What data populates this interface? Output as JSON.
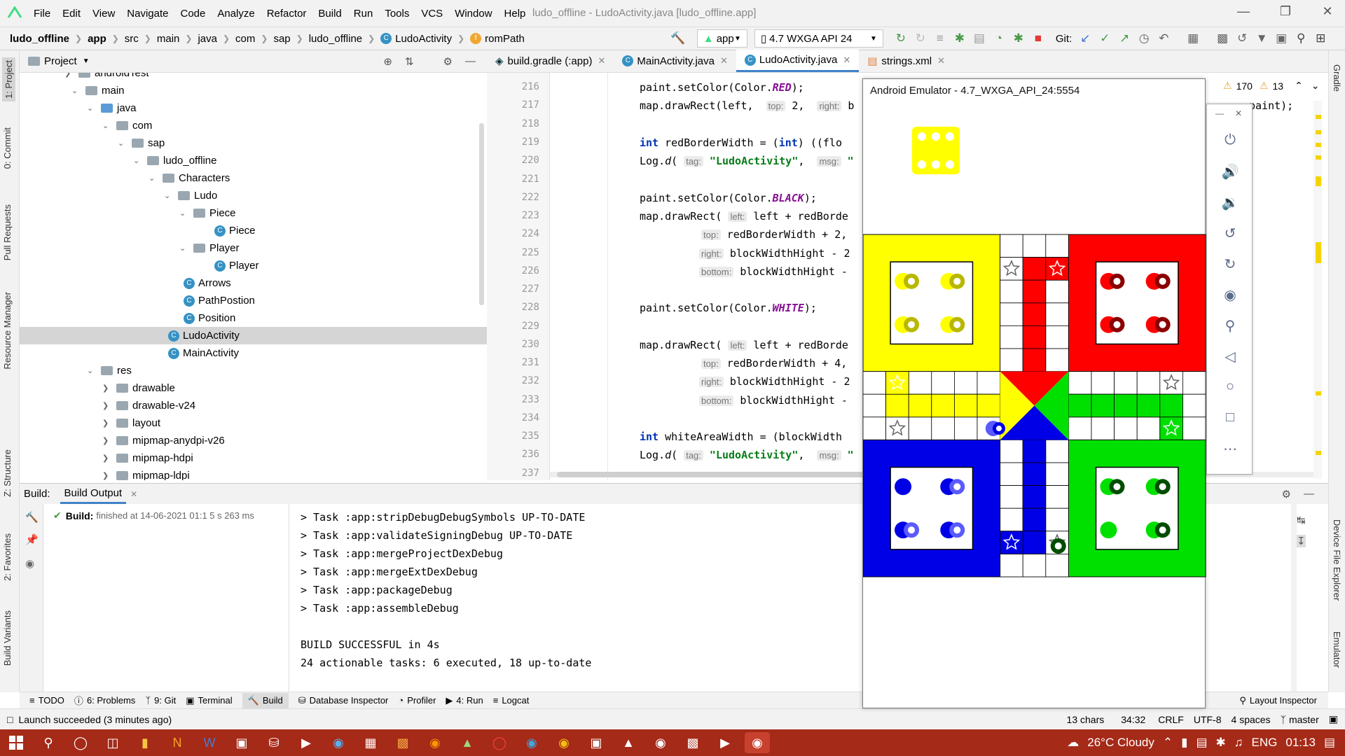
{
  "menu": {
    "items": [
      "File",
      "Edit",
      "View",
      "Navigate",
      "Code",
      "Analyze",
      "Refactor",
      "Build",
      "Run",
      "Tools",
      "VCS",
      "Window",
      "Help"
    ],
    "title": "ludo_offline - LudoActivity.java [ludo_offline.app]"
  },
  "nav": {
    "breadcrumbs": [
      "ludo_offline",
      "app",
      "src",
      "main",
      "java",
      "com",
      "sap",
      "ludo_offline",
      "LudoActivity",
      "romPath"
    ],
    "run_config": "app",
    "device": "4.7  WXGA API 24",
    "git_label": "Git:"
  },
  "project": {
    "label": "Project"
  },
  "tree": [
    {
      "label": "androidTest"
    },
    {
      "label": "main"
    },
    {
      "label": "java"
    },
    {
      "label": "com"
    },
    {
      "label": "sap"
    },
    {
      "label": "ludo_offline"
    },
    {
      "label": "Characters"
    },
    {
      "label": "Ludo"
    },
    {
      "label": "Piece"
    },
    {
      "label": "Piece"
    },
    {
      "label": "Player"
    },
    {
      "label": "Player"
    },
    {
      "label": "Arrows"
    },
    {
      "label": "PathPostion"
    },
    {
      "label": "Position"
    },
    {
      "label": "LudoActivity"
    },
    {
      "label": "MainActivity"
    },
    {
      "label": "res"
    },
    {
      "label": "drawable"
    },
    {
      "label": "drawable-v24"
    },
    {
      "label": "layout"
    },
    {
      "label": "mipmap-anydpi-v26"
    },
    {
      "label": "mipmap-hdpi"
    },
    {
      "label": "mipmap-ldpi"
    }
  ],
  "editor_tabs": [
    "build.gradle (:app)",
    "MainActivity.java",
    "LudoActivity.java",
    "strings.xml"
  ],
  "line_numbers": [
    "216",
    "217",
    "218",
    "219",
    "220",
    "221",
    "222",
    "223",
    "224",
    "225",
    "226",
    "227",
    "228",
    "229",
    "230",
    "231",
    "232",
    "233",
    "234",
    "235",
    "236",
    "237"
  ],
  "code": {
    "l216a": "paint.setColor(Color.",
    "l216b": "RED",
    "l216c": ");",
    "l217a": "map.drawRect(left,  ",
    "l217h1": "top:",
    "l217b": " 2,  ",
    "l217h2": "right:",
    "l217c": " b",
    "l219a": "int",
    "l219b": " redBorderWidth = (",
    "l219c": "int",
    "l219d": ") ((flo",
    "l220a": "Log.",
    "l220b": "d",
    "l220c": "( ",
    "l220h": "tag:",
    "l220s": " \"LudoActivity\"",
    "l220d": ",  ",
    "l220h2": "msg:",
    "l220e": " \"",
    "l222a": "paint.setColor(Color.",
    "l222b": "BLACK",
    "l222c": ");",
    "l223a": "map.drawRect( ",
    "l223h": "left:",
    "l223b": " left + redBorde",
    "l224h": "top:",
    "l224b": " redBorderWidth + 2,",
    "l225h": "right:",
    "l225b": " blockWidthHight - 2",
    "l226h": "bottom:",
    "l226b": " blockWidthHight -",
    "l228a": "paint.setColor(Color.",
    "l228b": "WHITE",
    "l228c": ");",
    "l230a": "map.drawRect( ",
    "l230h": "left:",
    "l230b": " left + redBorde",
    "l231h": "top:",
    "l231b": " redBorderWidth + 4,",
    "l232h": "right:",
    "l232b": " blockWidthHight - 2",
    "l233h": "bottom:",
    "l233b": " blockWidthHight -",
    "l235a": "int",
    "l235b": " whiteAreaWidth = (blockWidth",
    "l236a": "Log.",
    "l236b": "d",
    "l236c": "( ",
    "l236h": "tag:",
    "l236s": " \"LudoActivity\"",
    "l236d": ",  ",
    "l236h2": "msg:",
    "l236e": " \"",
    "right_fragment": "paint);"
  },
  "inspections": {
    "warnings": "170",
    "weak": "13"
  },
  "emulator": {
    "title": "Android Emulator - 4.7_WXGA_API_24:5554",
    "dice_value": 6
  },
  "build": {
    "tab_build": "Build:",
    "tab_output": "Build Output",
    "status_label": "Build:",
    "status_text": "finished at 14-06-2021 01:1 5 s 263 ms",
    "lines": [
      "> Task :app:stripDebugDebugSymbols UP-TO-DATE",
      "> Task :app:validateSigningDebug UP-TO-DATE",
      "> Task :app:mergeProjectDexDebug",
      "> Task :app:mergeExtDexDebug",
      "> Task :app:packageDebug",
      "> Task :app:assembleDebug",
      "",
      "BUILD SUCCESSFUL in 4s",
      "24 actionable tasks: 6 executed, 18 up-to-date"
    ]
  },
  "tool_tabs": [
    "TODO",
    "6: Problems",
    "9: Git",
    "Terminal",
    "Build",
    "Database Inspector",
    "Profiler",
    "4: Run",
    "Logcat",
    "Layout Inspector"
  ],
  "status": {
    "message": "Launch succeeded (3 minutes ago)",
    "chars": "13 chars",
    "position": "34:32",
    "line_sep": "CRLF",
    "encoding": "UTF-8",
    "indent": "4 spaces",
    "branch": "master"
  },
  "left_tabs": [
    "1: Project",
    "0: Commit",
    "Pull Requests",
    "Resource Manager",
    "Z: Structure",
    "2: Favorites",
    "Build Variants"
  ],
  "right_tabs": [
    "Gradle",
    "Device File Explorer",
    "Emulator"
  ],
  "taskbar": {
    "weather": "26°C  Cloudy",
    "lang": "ENG",
    "time": "01:13"
  },
  "colors": {
    "ludo_yellow": "#ffff00",
    "ludo_red": "#ff0000",
    "ludo_green": "#00e000",
    "ludo_blue": "#0000e6",
    "taskbar": "#a52a18",
    "keyword": "#0033b3",
    "string": "#067d17"
  }
}
